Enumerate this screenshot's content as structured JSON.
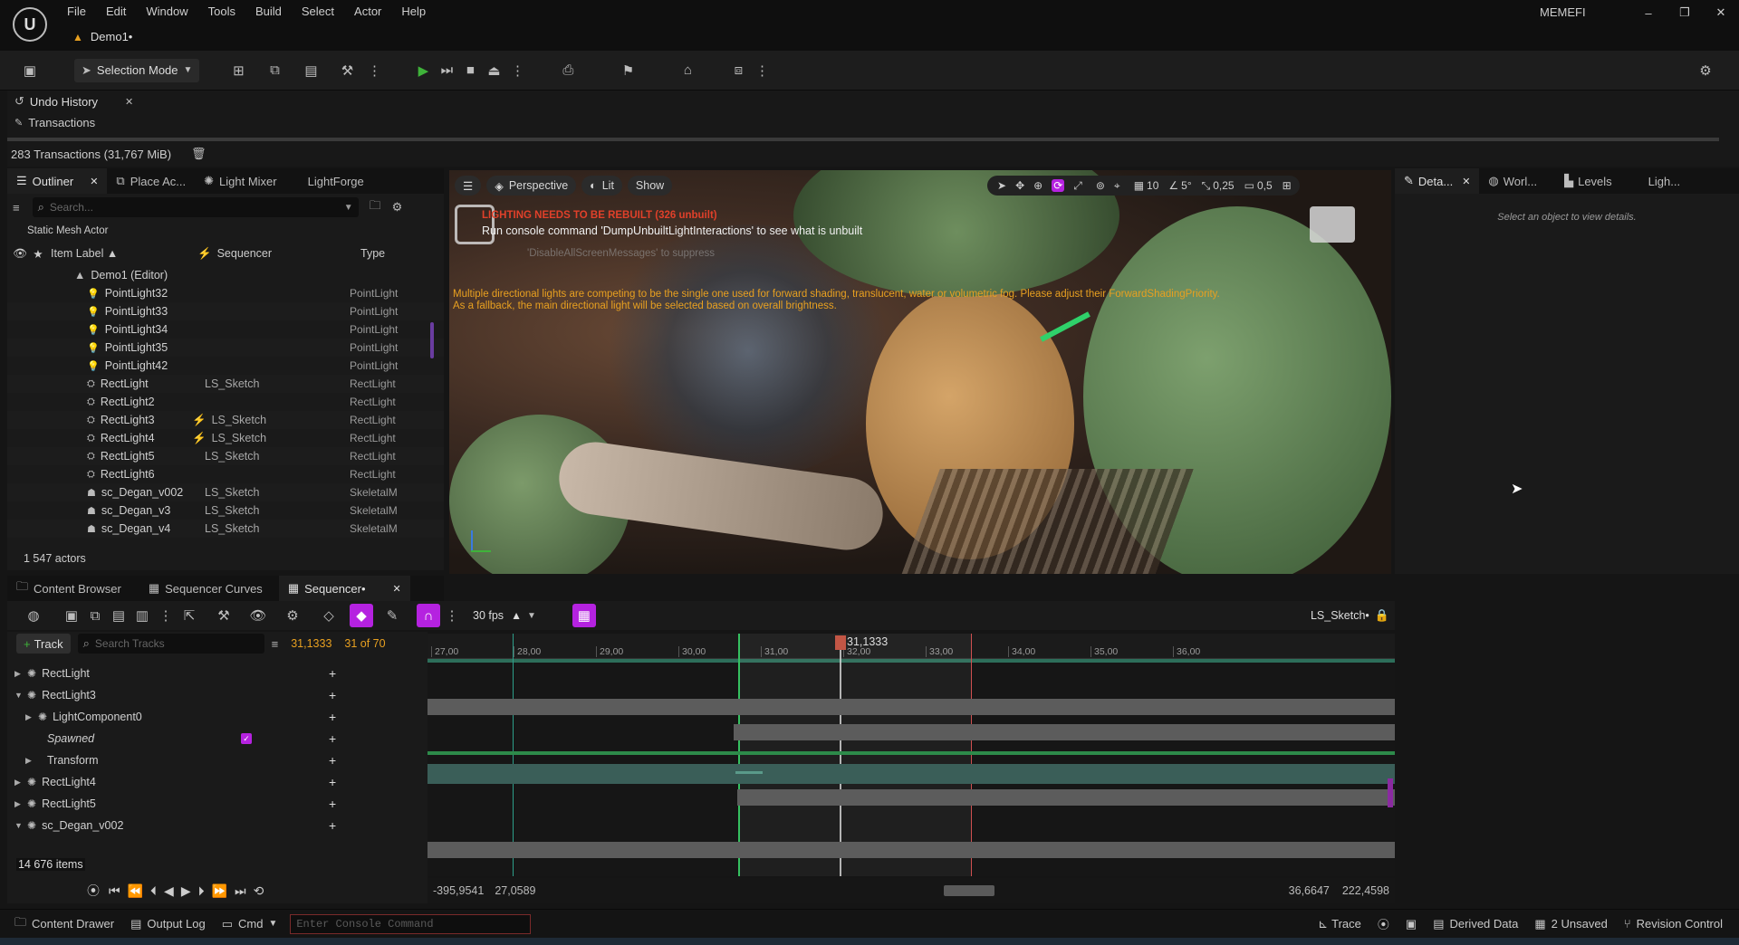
{
  "window": {
    "project_name": "MEMEFI",
    "level_tab": "Demo1•",
    "menu": [
      "File",
      "Edit",
      "Window",
      "Tools",
      "Build",
      "Select",
      "Actor",
      "Help"
    ],
    "controls": [
      "–",
      "❐",
      "✕"
    ]
  },
  "toolbar": {
    "selection_mode": "Selection Mode"
  },
  "undo": {
    "tab_label": "Undo History",
    "transactions_label": "Transactions",
    "summary": "283 Transactions (31,767 MiB)"
  },
  "outliner": {
    "tabs": [
      "Outliner",
      "Place Ac...",
      "Light Mixer",
      "LightForge"
    ],
    "search_placeholder": "Search...",
    "filter_label": "Static Mesh Actor",
    "col_item": "Item Label",
    "col_seq": "Sequencer",
    "col_type": "Type",
    "root": "Demo1 (Editor)",
    "rows": [
      {
        "label": "PointLight32",
        "seq": "",
        "type": "PointLight",
        "icon": "bulb",
        "bolt": false
      },
      {
        "label": "PointLight33",
        "seq": "",
        "type": "PointLight",
        "icon": "bulb",
        "bolt": false
      },
      {
        "label": "PointLight34",
        "seq": "",
        "type": "PointLight",
        "icon": "bulb",
        "bolt": false
      },
      {
        "label": "PointLight35",
        "seq": "",
        "type": "PointLight",
        "icon": "bulb",
        "bolt": false
      },
      {
        "label": "PointLight42",
        "seq": "",
        "type": "PointLight",
        "icon": "bulb",
        "bolt": false
      },
      {
        "label": "RectLight",
        "seq": "LS_Sketch",
        "type": "RectLight",
        "icon": "rect",
        "bolt": false
      },
      {
        "label": "RectLight2",
        "seq": "",
        "type": "RectLight",
        "icon": "rect",
        "bolt": false
      },
      {
        "label": "RectLight3",
        "seq": "LS_Sketch",
        "type": "RectLight",
        "icon": "rect",
        "bolt": true
      },
      {
        "label": "RectLight4",
        "seq": "LS_Sketch",
        "type": "RectLight",
        "icon": "rect",
        "bolt": true
      },
      {
        "label": "RectLight5",
        "seq": "LS_Sketch",
        "type": "RectLight",
        "icon": "rect",
        "bolt": false
      },
      {
        "label": "RectLight6",
        "seq": "",
        "type": "RectLight",
        "icon": "rect",
        "bolt": false
      },
      {
        "label": "sc_Degan_v002",
        "seq": "LS_Sketch",
        "type": "SkeletalM",
        "icon": "skel",
        "bolt": false
      },
      {
        "label": "sc_Degan_v3",
        "seq": "LS_Sketch",
        "type": "SkeletalM",
        "icon": "skel",
        "bolt": false
      },
      {
        "label": "sc_Degan_v4",
        "seq": "LS_Sketch",
        "type": "SkeletalM",
        "icon": "skel",
        "bolt": false
      }
    ],
    "actor_count": "1 547 actors"
  },
  "viewport": {
    "perspective": "Perspective",
    "lit": "Lit",
    "show": "Show",
    "grid_snap": "10",
    "angle_snap": "5°",
    "scale_snap": "0,25",
    "cam_speed": "0,5",
    "warning1": "LIGHTING NEEDS TO BE REBUILT (326 unbuilt)",
    "warning2": "Run console command 'DumpUnbuiltLightInteractions' to see what is unbuilt",
    "warning3": "'DisableAllScreenMessages' to suppress",
    "warning4": "Multiple directional lights are competing to be the single one used for forward shading, translucent, water or volumetric fog. Please adjust their ForwardShadingPriority.",
    "warning5": "As a fallback, the main directional light will be selected based on overall brightness."
  },
  "details": {
    "tabs": [
      "Deta...",
      "Worl...",
      "Levels",
      "Ligh..."
    ],
    "empty_text": "Select an object to view details."
  },
  "bottom_tabs": [
    "Content Browser",
    "Sequencer Curves",
    "Sequencer•"
  ],
  "sequencer": {
    "fps": "30 fps",
    "sequence_name": "LS_Sketch•",
    "track_button": "Track",
    "search_placeholder": "Search Tracks",
    "current_time": "31,1333",
    "frame_of": "31 of 70",
    "playhead_label": "31,1333",
    "ruler": [
      "27,00",
      "28,00",
      "29,00",
      "30,00",
      "31,00",
      "32,00",
      "33,00",
      "34,00",
      "35,00",
      "36,00"
    ],
    "tracks": [
      {
        "label": "RectLight",
        "indent": 0,
        "italic": false,
        "expand": "▶"
      },
      {
        "label": "RectLight3",
        "indent": 0,
        "italic": false,
        "expand": "▼"
      },
      {
        "label": "LightComponent0",
        "indent": 1,
        "italic": false,
        "expand": "▶"
      },
      {
        "label": "Spawned",
        "indent": 1,
        "italic": true,
        "expand": ""
      },
      {
        "label": "Transform",
        "indent": 1,
        "italic": false,
        "expand": "▶"
      },
      {
        "label": "RectLight4",
        "indent": 0,
        "italic": false,
        "expand": "▶"
      },
      {
        "label": "RectLight5",
        "indent": 0,
        "italic": false,
        "expand": "▶"
      },
      {
        "label": "sc_Degan_v002",
        "indent": 0,
        "italic": false,
        "expand": "▼"
      }
    ],
    "item_count": "14 676 items",
    "range_start": "-395,9541",
    "view_start": "27,0589",
    "view_end": "36,6647",
    "range_end": "222,4598"
  },
  "statusbar": {
    "content_drawer": "Content Drawer",
    "output_log": "Output Log",
    "cmd": "Cmd",
    "console_placeholder": "Enter Console Command",
    "trace": "Trace",
    "derived_data": "Derived Data",
    "unsaved": "2 Unsaved",
    "revision_control": "Revision Control"
  },
  "colors": {
    "accent_purple": "#b522e0",
    "play_green": "#3fb33a",
    "warning_red": "#e0402a",
    "warning_orange": "#e8a020",
    "section_green": "#2d6e5a",
    "playhead": "#c0503e"
  }
}
